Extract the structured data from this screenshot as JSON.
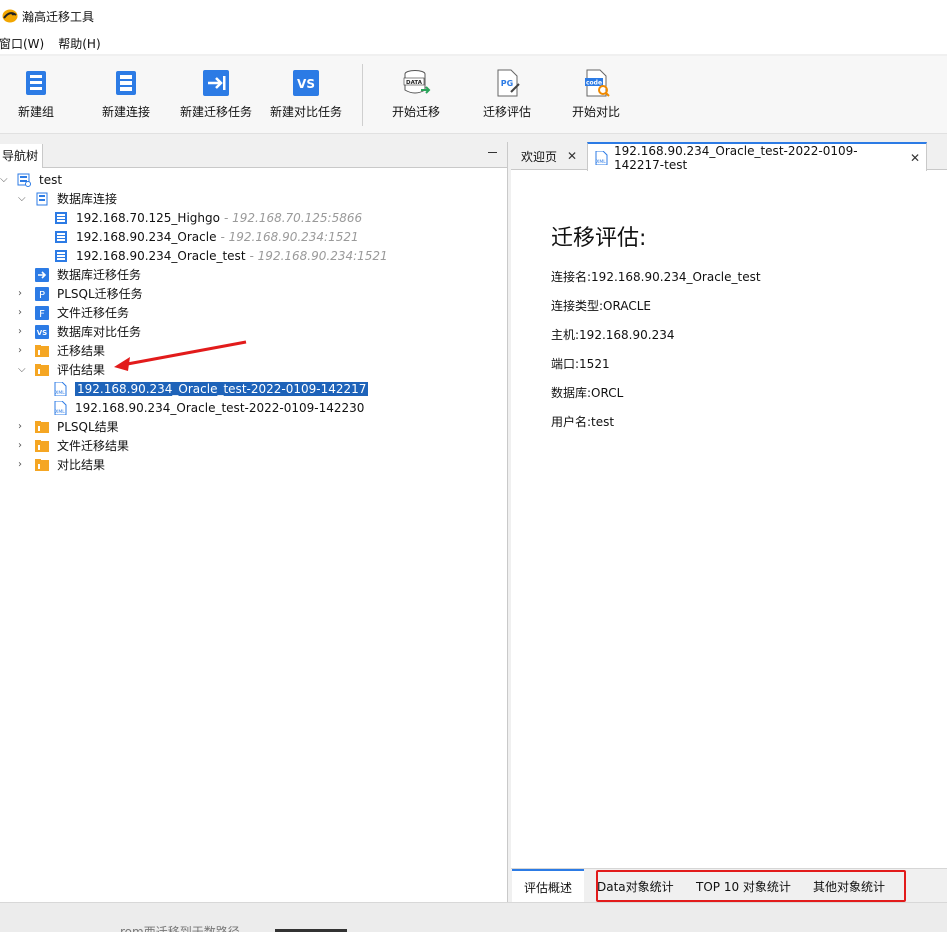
{
  "window": {
    "title": "瀚高迁移工具"
  },
  "menu": [
    {
      "label": "窗口(W)"
    },
    {
      "label": "帮助(H)"
    }
  ],
  "toolbar": {
    "buttons": [
      {
        "label": "新建组",
        "icon": "new-group-icon"
      },
      {
        "label": "新建连接",
        "icon": "new-connection-icon"
      },
      {
        "label": "新建迁移任务",
        "icon": "new-migration-task-icon"
      },
      {
        "label": "新建对比任务",
        "icon": "new-compare-task-icon"
      },
      {
        "label": "开始迁移",
        "icon": "start-migration-icon",
        "glyph": "DATA"
      },
      {
        "label": "迁移评估",
        "icon": "migration-evaluation-icon",
        "glyph": "PG"
      },
      {
        "label": "开始对比",
        "icon": "start-compare-icon",
        "glyph": "code"
      }
    ]
  },
  "left_panel": {
    "title": "导航树",
    "tree": [
      {
        "label": "test"
      },
      {
        "label": "数据库连接"
      },
      {
        "label": "192.168.70.125_Highgo",
        "secondary": "- 192.168.70.125:5866"
      },
      {
        "label": "192.168.90.234_Oracle",
        "secondary": "- 192.168.90.234:1521"
      },
      {
        "label": "192.168.90.234_Oracle_test",
        "secondary": "- 192.168.90.234:1521"
      },
      {
        "label": "数据库迁移任务"
      },
      {
        "label": "PLSQL迁移任务"
      },
      {
        "label": "文件迁移任务"
      },
      {
        "label": "数据库对比任务"
      },
      {
        "label": "迁移结果"
      },
      {
        "label": "评估结果"
      },
      {
        "label": "192.168.90.234_Oracle_test-2022-0109-142217"
      },
      {
        "label": "192.168.90.234_Oracle_test-2022-0109-142230"
      },
      {
        "label": "PLSQL结果"
      },
      {
        "label": "文件迁移结果"
      },
      {
        "label": "对比结果"
      }
    ],
    "icon_glyphs": {
      "plsql": "P",
      "file": "F",
      "vs": "VS",
      "xml": "XML"
    }
  },
  "right_panel": {
    "tabs": [
      {
        "label": "欢迎页"
      },
      {
        "label": "192.168.90.234_Oracle_test-2022-0109-142217-test",
        "icon_glyph": "XML"
      }
    ],
    "content": {
      "title": "迁移评估:",
      "lines": [
        "连接名:192.168.90.234_Oracle_test",
        "连接类型:ORACLE",
        "主机:192.168.90.234",
        "端口:1521",
        "数据库:ORCL",
        "用户名:test"
      ]
    },
    "bottom_tabs": [
      {
        "label": "评估概述"
      },
      {
        "label": "Data对象统计"
      },
      {
        "label": "TOP 10 对象统计"
      },
      {
        "label": "其他对象统计"
      }
    ]
  },
  "status": {
    "text": "rom西迁移到于数路径"
  },
  "colors": {
    "accent": "#2c7be5",
    "selection": "#1e63b9",
    "annotation": "#e21b1b",
    "folder": "#f5a623"
  }
}
